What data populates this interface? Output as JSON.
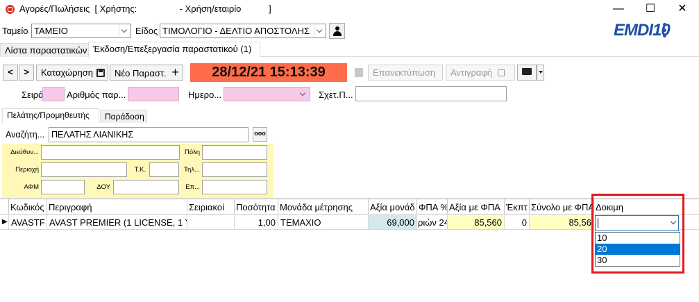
{
  "window": {
    "title": "Αγορές/Πωλήσεις  [ Χρήστης:                 - Χρήση/εταιρίο           ]",
    "minimize": "—",
    "maximize": "☐",
    "close": "✕"
  },
  "header": {
    "register_label": "Ταμείο",
    "register_value": "ΤΑΜΕΙΟ",
    "type_label": "Είδος",
    "type_value": "ΤΙΜΟΛΟΓΙΟ - ΔΕΛΤΙΟ ΑΠΟΣΤΟΛΗΣ",
    "logo": "EMDI10"
  },
  "tabs": [
    {
      "label": "Λίστα παραστατικών"
    },
    {
      "label": "Έκδοση/Επεξεργασία παραστατικού (1)"
    }
  ],
  "toolbar": {
    "prev": "<",
    "next": ">",
    "save": "Καταχώρηση",
    "new": "Νέο Παραστ.",
    "plus": "+",
    "datetime": "28/12/21 15:13:39",
    "reprint": "Επανεκτύπωση",
    "copy": "Αντιγραφή"
  },
  "fields": {
    "series_label": "Σειρά",
    "docnum_label": "Αριθμός παρ...",
    "date_label": "Ημερο...",
    "related_label": "Σχετ.Π..."
  },
  "subtabs": [
    {
      "label": "Πελάτης/Προμηθευτής"
    },
    {
      "label": "Παράδοση"
    }
  ],
  "customer": {
    "search_label": "Αναζήτη...",
    "search_value": "ΠΕΛΑΤΗΣ ΛΙΑΝΙΚΗΣ",
    "more_button": "ooo",
    "address_label": "Διεύθυν...",
    "city_label": "Πόλη",
    "area_label": "Περιοχή",
    "zip_label": "Τ.Κ.",
    "phone_label": "Τηλ...",
    "afm_label": "ΑΦΜ",
    "doy_label": "ΔΟΥ",
    "profession_label": "Επ..."
  },
  "grid": {
    "columns": [
      "Κωδικός",
      "Περιγραφή",
      "Σειριακοί",
      "Ποσότητα",
      "Μονάδα μέτρησης",
      "Αξία μονάδ",
      "ΦΠΑ %",
      "Αξία με ΦΠΑ",
      "Έκπτ",
      "Σύνολο με ΦΠΑ",
      "Δοκιμη"
    ],
    "row": {
      "marker": "▶",
      "code": "AVASTF",
      "description": "AVAST PREMIER (1 LICENSE, 1 Y",
      "serials": "",
      "quantity": "1,00",
      "unit": "ΤΕΜΑΧΙΟ",
      "unit_value": "69,000",
      "vat": "ριών 24",
      "value_with_vat": "85,560",
      "discount": "0",
      "total_with_vat": "85,56",
      "test": ""
    }
  },
  "dropdown": {
    "options": [
      "10",
      "20",
      "30"
    ],
    "highlighted": "20"
  }
}
